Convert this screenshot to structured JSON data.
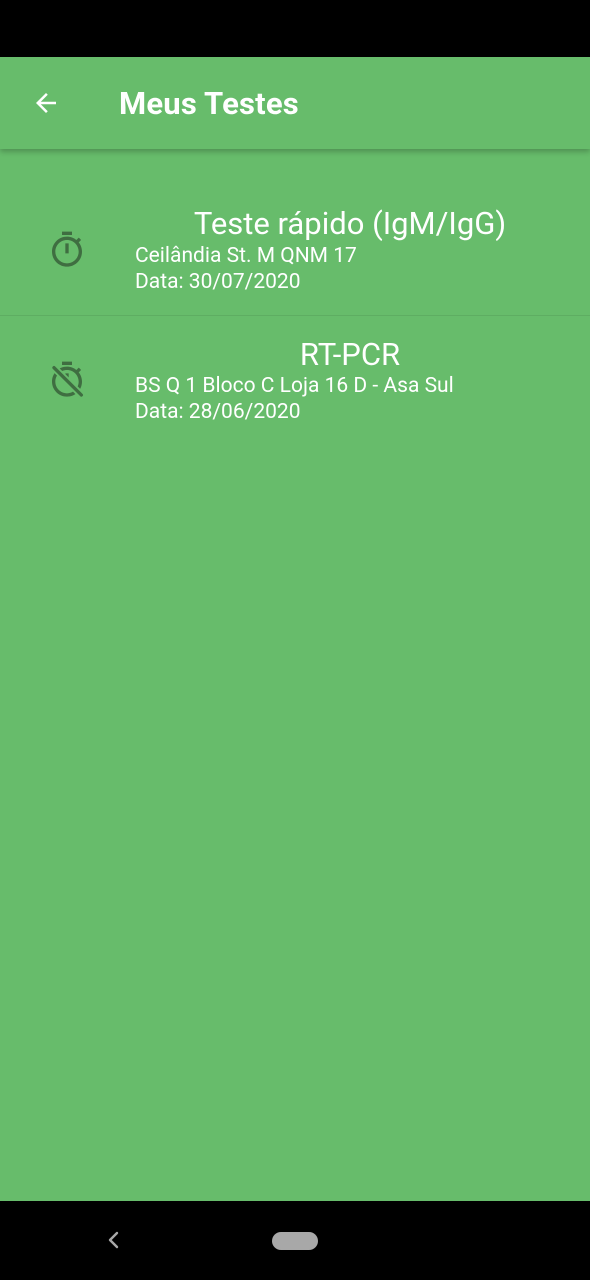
{
  "app_bar": {
    "title": "Meus Testes",
    "back_icon": "arrow-left-icon"
  },
  "tests": [
    {
      "title": "Teste rápido (IgM/IgG)",
      "address": "Ceilândia St. M QNM 17",
      "date": "Data: 30/07/2020",
      "icon": "timer-icon"
    },
    {
      "title": "RT-PCR",
      "address": "BS Q 1 Bloco C Loja 16 D - Asa Sul",
      "date": "Data: 28/06/2020",
      "icon": "timer-off-icon"
    }
  ],
  "colors": {
    "background": "#67bc6b",
    "icon": "#3f6e41",
    "text": "#ffffff",
    "system_bars": "#000000"
  },
  "nav_bar": {
    "back_icon": "chevron-left-icon",
    "home_icon": "home-pill-icon"
  }
}
